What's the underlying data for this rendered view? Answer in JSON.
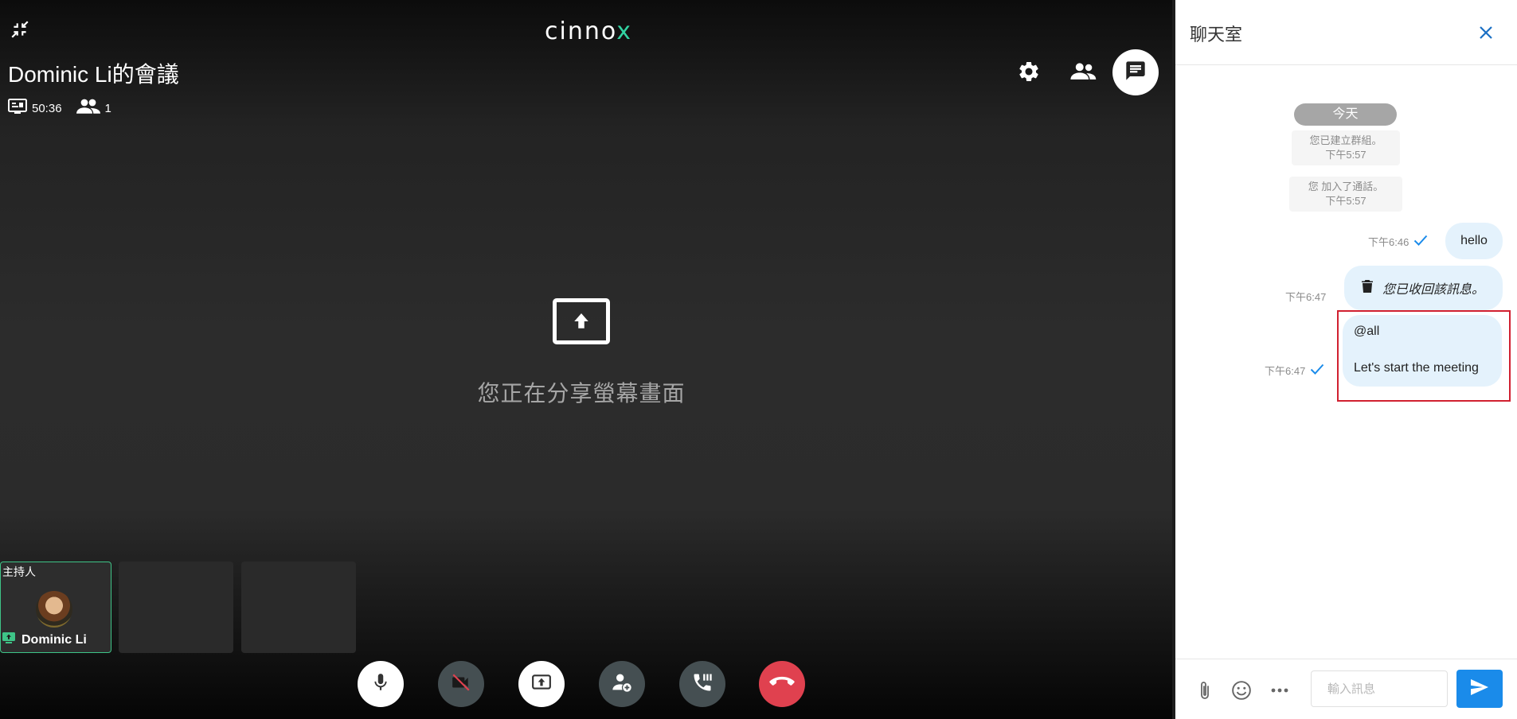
{
  "meeting": {
    "logo_text": "cinno",
    "logo_x": "x",
    "title": "Dominic Li的會議",
    "duration": "50:36",
    "participant_count": "1",
    "share_message": "您正在分享螢幕畫面",
    "host_label": "主持人",
    "host_name": "Dominic Li",
    "accent_color": "#32d3a2",
    "hangup_color": "#e0414f"
  },
  "chat": {
    "title": "聊天室",
    "date_pill": "今天",
    "system_messages": [
      {
        "text": "您已建立群組。",
        "time": "下午5:57"
      },
      {
        "text": "您 加入了通話。",
        "time": "下午5:57"
      }
    ],
    "messages": [
      {
        "time": "下午6:46",
        "text": "hello",
        "status": "check-icon"
      },
      {
        "time": "下午6:47",
        "text": "您已收回該訊息。",
        "status": "trash-icon"
      },
      {
        "time": "下午6:47",
        "mention": "@all",
        "text": "Let's start the meeting",
        "status": "check-icon"
      }
    ],
    "input_placeholder": "輸入訊息",
    "send_color": "#1a8bea"
  }
}
